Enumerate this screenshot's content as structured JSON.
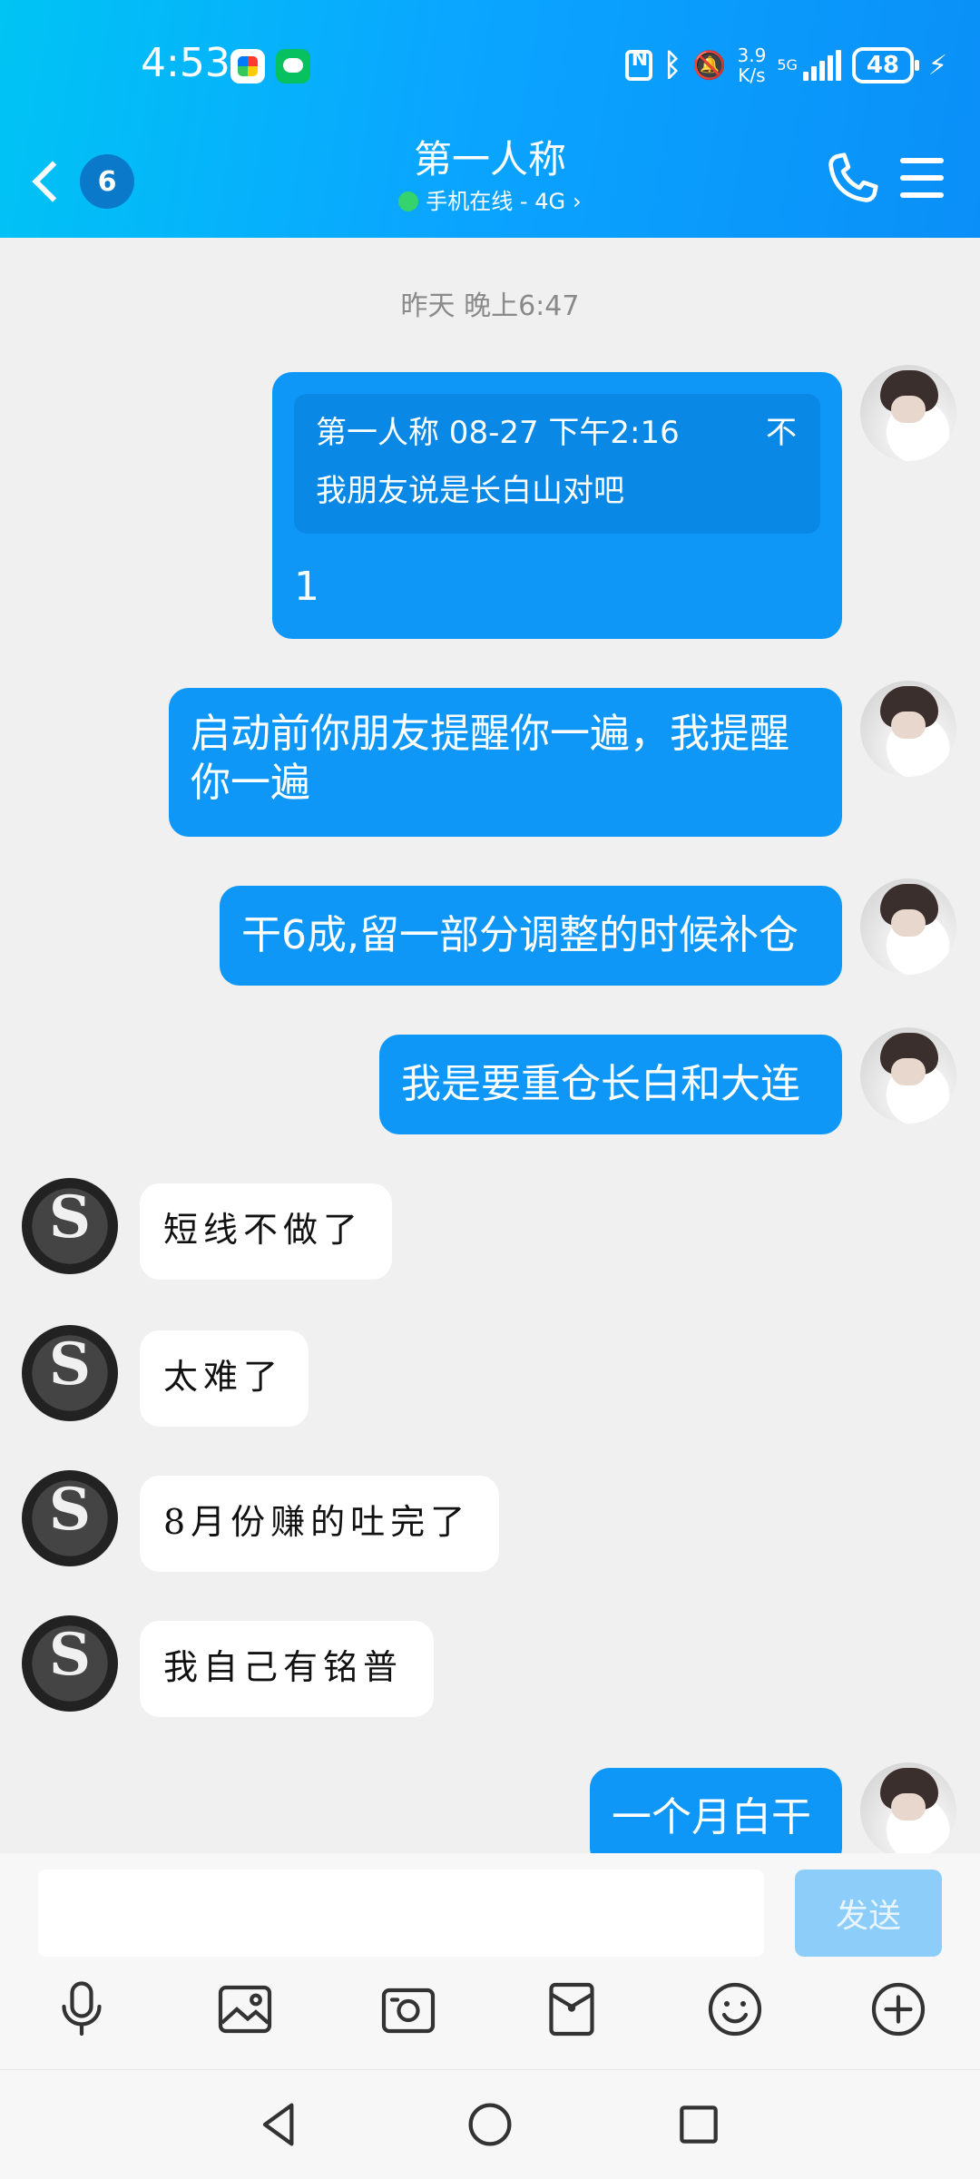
{
  "status_bar": {
    "time": "4:53",
    "net_speed_value": "3.9",
    "net_speed_unit": "K/s",
    "network": "5G",
    "battery": "48",
    "icons": [
      "nfc-icon",
      "bluetooth-icon",
      "mute-icon",
      "signal-icon",
      "battery-icon",
      "charging-icon"
    ]
  },
  "header": {
    "back_count": "6",
    "title": "第一人称",
    "subtitle": "手机在线 - 4G",
    "subtitle_chevron": "›",
    "online_color": "#34d36e"
  },
  "chat": {
    "timestamp": "昨天 晚上6:47",
    "quote": {
      "meta": "第一人称 08-27 下午2:16",
      "close": "不",
      "text": "我朋友说是长白山对吧",
      "reply": "1"
    },
    "messages": [
      "启动前你朋友提醒你一遍，我提醒你一遍",
      "干6成,留一部分调整的时候补仓",
      "我是要重仓长白和大连",
      "短线不做了",
      "太难了",
      "8月份赚的吐完了",
      "我自己有铭普",
      "一个月白干"
    ]
  },
  "input": {
    "value": "",
    "placeholder": "",
    "send_label": "发送"
  },
  "toolbar": [
    "microphone-icon",
    "image-icon",
    "camera-icon",
    "red-packet-icon",
    "emoji-icon",
    "plus-icon"
  ],
  "nav": [
    "back-nav-icon",
    "home-nav-icon",
    "recents-nav-icon"
  ],
  "colors": {
    "header_from": "#00c4f4",
    "header_to": "#0a8ff8",
    "my_bubble": "#0f97f7",
    "quote_bg": "#0a88e6",
    "send_disabled": "#8ccdf9"
  }
}
